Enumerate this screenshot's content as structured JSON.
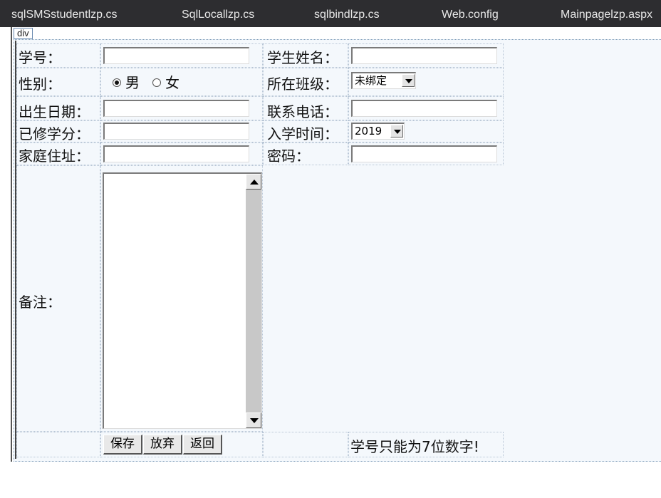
{
  "tabs": [
    {
      "label": "sqlSMSstudentlzp.cs"
    },
    {
      "label": "SqlLocallzp.cs"
    },
    {
      "label": "sqlbindlzp.cs"
    },
    {
      "label": "Web.config"
    },
    {
      "label": "Mainpagelzp.aspx"
    }
  ],
  "div_tag": "div",
  "form": {
    "student_id_label": "学号：",
    "student_name_label": "学生姓名：",
    "gender_label": "性别：",
    "gender_options": [
      {
        "label": "男",
        "checked": true
      },
      {
        "label": "女",
        "checked": false
      }
    ],
    "class_label": "所在班级：",
    "class_selected": "未绑定",
    "birth_date_label": "出生日期：",
    "phone_label": "联系电话：",
    "credits_label": "已修学分：",
    "enroll_time_label": "入学时间：",
    "enroll_year_selected": "2019",
    "address_label": "家庭住址：",
    "password_label": "密码：",
    "notes_label": "备注：",
    "save_button": "保存",
    "discard_button": "放弃",
    "back_button": "返回",
    "validation_message": "学号只能为7位数字!"
  }
}
